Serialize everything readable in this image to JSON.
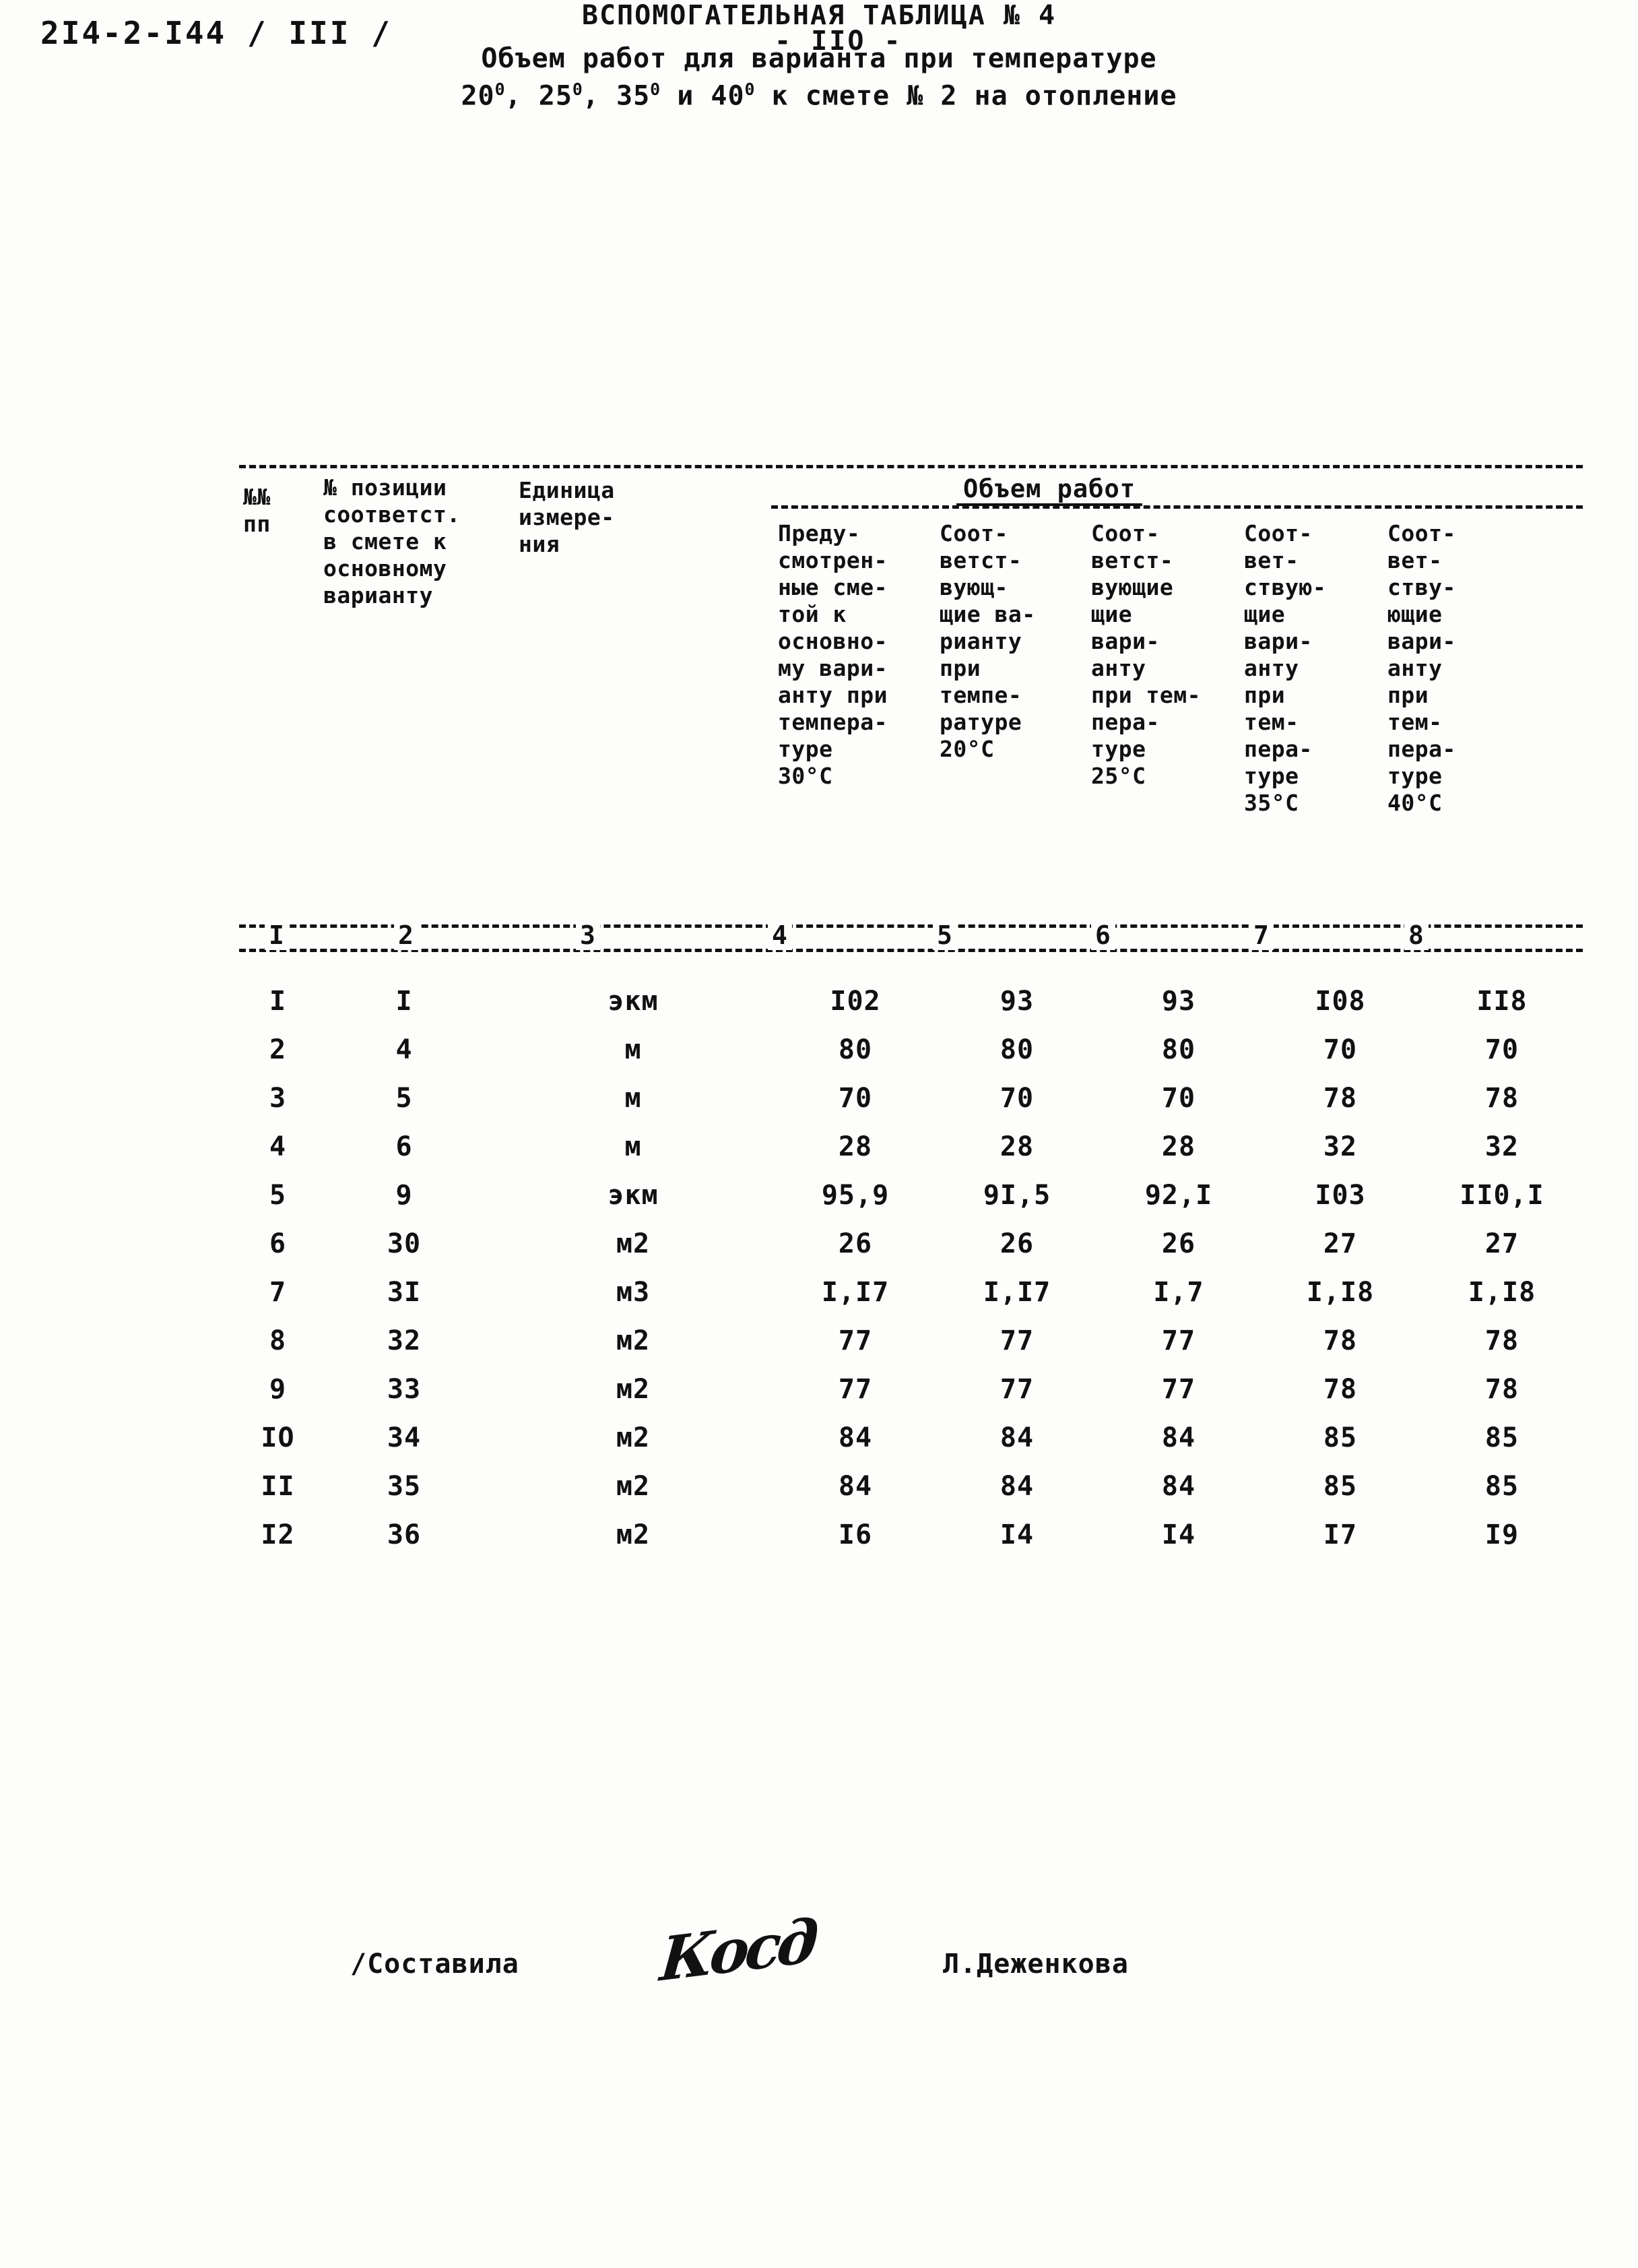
{
  "header": {
    "doc_code": "2I4-2-I44 / III /",
    "page_number": "- IIO -"
  },
  "title": {
    "line1": "ВСПОМОГАТЕЛЬНАЯ ТАБЛИЦА № 4",
    "line2": "Объем работ для варианта при температуре",
    "line3_a": "20",
    "line3_b": ", 25",
    "line3_c": ", 35",
    "line3_d": " и 40",
    "line3_e": " к смете № 2 на отопление",
    "degree": "0"
  },
  "table": {
    "group_header": "Объем работ",
    "columns": [
      {
        "num": "I",
        "label": "№№\nпп"
      },
      {
        "num": "2",
        "label": "№ позиции\nсоответст.\nв смете к\nосновному\nварианту"
      },
      {
        "num": "3",
        "label": "Единица\nизмере-\nния"
      },
      {
        "num": "4",
        "label": "Преду-\nсмотрен-\nные сме-\nтой к\nосновно-\nму вари-\nанту при\nтемпера-\nтуре\n30°С"
      },
      {
        "num": "5",
        "label": "Соот-\nветст-\nвующ-\nщие ва-\nрианту\nпри\nтемпе-\nратуре\n20°С"
      },
      {
        "num": "6",
        "label": "Соот-\nветст-\nвующие\nщие\nвари-\nанту\nпри тем-\nпера-\nтуре\n25°С"
      },
      {
        "num": "7",
        "label": "Соот-\nвет-\nствую-\nщие\nвари-\nанту\nпри\nтем-\nпера-\nтуре\n35°С"
      },
      {
        "num": "8",
        "label": "Соот-\nвет-\nству-\nющие\nвари-\nанту\nпри\nтем-\nпера-\nтуре\n40°С"
      }
    ],
    "rows": [
      {
        "no": "I",
        "pos": "I",
        "unit": "экм",
        "v30": "I02",
        "v20": "93",
        "v25": "93",
        "v35": "I08",
        "v40": "II8"
      },
      {
        "no": "2",
        "pos": "4",
        "unit": "м",
        "v30": "80",
        "v20": "80",
        "v25": "80",
        "v35": "70",
        "v40": "70"
      },
      {
        "no": "3",
        "pos": "5",
        "unit": "м",
        "v30": "70",
        "v20": "70",
        "v25": "70",
        "v35": "78",
        "v40": "78"
      },
      {
        "no": "4",
        "pos": "6",
        "unit": "м",
        "v30": "28",
        "v20": "28",
        "v25": "28",
        "v35": "32",
        "v40": "32"
      },
      {
        "no": "5",
        "pos": "9",
        "unit": "экм",
        "v30": "95,9",
        "v20": "9I,5",
        "v25": "92,I",
        "v35": "I03",
        "v40": "II0,I"
      },
      {
        "no": "6",
        "pos": "30",
        "unit": "м2",
        "v30": "26",
        "v20": "26",
        "v25": "26",
        "v35": "27",
        "v40": "27"
      },
      {
        "no": "7",
        "pos": "3I",
        "unit": "м3",
        "v30": "I,I7",
        "v20": "I,I7",
        "v25": "I,7",
        "v35": "I,I8",
        "v40": "I,I8"
      },
      {
        "no": "8",
        "pos": "32",
        "unit": "м2",
        "v30": "77",
        "v20": "77",
        "v25": "77",
        "v35": "78",
        "v40": "78"
      },
      {
        "no": "9",
        "pos": "33",
        "unit": "м2",
        "v30": "77",
        "v20": "77",
        "v25": "77",
        "v35": "78",
        "v40": "78"
      },
      {
        "no": "IO",
        "pos": "34",
        "unit": "м2",
        "v30": "84",
        "v20": "84",
        "v25": "84",
        "v35": "85",
        "v40": "85"
      },
      {
        "no": "II",
        "pos": "35",
        "unit": "м2",
        "v30": "84",
        "v20": "84",
        "v25": "84",
        "v35": "85",
        "v40": "85"
      },
      {
        "no": "I2",
        "pos": "36",
        "unit": "м2",
        "v30": "I6",
        "v20": "I4",
        "v25": "I4",
        "v35": "I7",
        "v40": "I9"
      }
    ]
  },
  "footer": {
    "compiled_by_label": "/Составила",
    "signature_mark": "Косд",
    "name": "Л.Деженкова"
  }
}
